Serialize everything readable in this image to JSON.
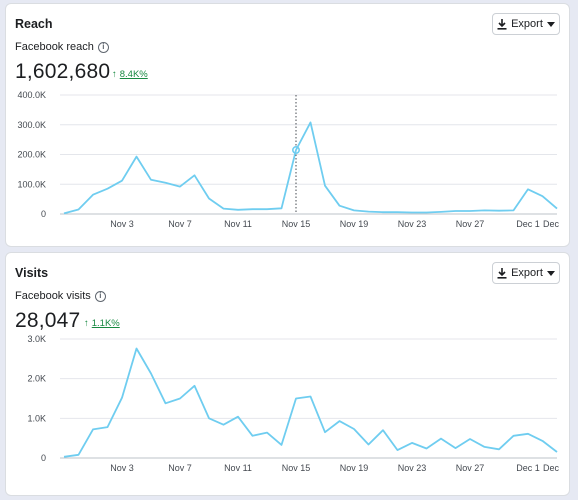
{
  "reach": {
    "title": "Reach",
    "export_label": "Export",
    "metric_label": "Facebook reach",
    "value": "1,602,680",
    "change": "8.4K%",
    "chart_data": {
      "type": "line",
      "color": "#6fcdf0",
      "x_ticks": [
        "Nov 3",
        "Nov 7",
        "Nov 11",
        "Nov 15",
        "Nov 19",
        "Nov 23",
        "Nov 27",
        "Dec 1",
        "Dec"
      ],
      "y_ticks": [
        "400.0K",
        "300.0K",
        "200.0K",
        "100.0K",
        "0"
      ],
      "ylim": [
        0,
        400000
      ],
      "grid": true,
      "hover_marker": "Nov 15",
      "values": [
        2000,
        15000,
        65000,
        85000,
        112000,
        193000,
        115000,
        105000,
        92000,
        130000,
        52000,
        18000,
        14000,
        16000,
        16000,
        19000,
        215000,
        308000,
        95000,
        28000,
        12000,
        8000,
        6000,
        6000,
        5000,
        5000,
        7000,
        10000,
        10000,
        12000,
        11000,
        12000,
        83000,
        60000,
        18000
      ]
    }
  },
  "visits": {
    "title": "Visits",
    "export_label": "Export",
    "metric_label": "Facebook visits",
    "value": "28,047",
    "change": "1.1K%",
    "chart_data": {
      "type": "line",
      "color": "#6fcdf0",
      "x_ticks": [
        "Nov 3",
        "Nov 7",
        "Nov 11",
        "Nov 15",
        "Nov 19",
        "Nov 23",
        "Nov 27",
        "Dec 1",
        "Dec"
      ],
      "y_ticks": [
        "3.0K",
        "2.0K",
        "1.0K",
        "0"
      ],
      "ylim": [
        0,
        3000
      ],
      "grid": true,
      "values": [
        30,
        80,
        720,
        780,
        1520,
        2760,
        2130,
        1380,
        1500,
        1820,
        1000,
        840,
        1040,
        560,
        640,
        330,
        1500,
        1550,
        650,
        930,
        730,
        340,
        700,
        200,
        380,
        240,
        490,
        250,
        480,
        280,
        220,
        560,
        610,
        430,
        150
      ]
    }
  }
}
